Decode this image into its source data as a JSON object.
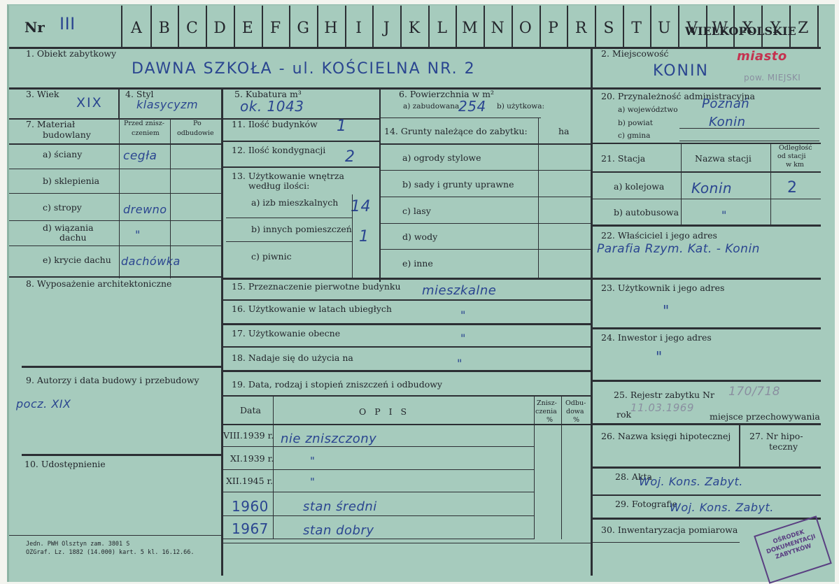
{
  "header": {
    "nr_label": "Nr",
    "nr_value": "III",
    "letters": [
      "A",
      "B",
      "C",
      "D",
      "E",
      "F",
      "G",
      "H",
      "I",
      "J",
      "K",
      "L",
      "M",
      "N",
      "O",
      "P",
      "R",
      "S",
      "T",
      "U",
      "V",
      "W",
      "X",
      "Y",
      "Z"
    ],
    "region": "WIELKOPOLSKIE"
  },
  "f1": {
    "label": "1. Obiekt zabytkowy",
    "value": "DAWNA SZKOŁA - ul. KOŚCIELNA NR. 2"
  },
  "f2": {
    "label": "2. Miejscowość",
    "value": "KONIN",
    "note": "miasto",
    "note2": "pow. MIEJSKI"
  },
  "f3": {
    "label": "3. Wiek",
    "value": "XIX"
  },
  "f4": {
    "label": "4. Styl",
    "value": "klasycyzm"
  },
  "f5": {
    "label": "5. Kubatura m³",
    "value": "ok. 1043"
  },
  "f6": {
    "label": "6. Powierzchnia w m²",
    "a_label": "a) zabudowana",
    "a_value": "254",
    "b_label": "b) użytkowa:"
  },
  "f20": {
    "label": "20. Przynależność administracyjna",
    "a_label": "a) województwo",
    "a_value": "Poznań",
    "b_label": "b) powiat",
    "b_value": "Konin",
    "c_label": "c) gmina"
  },
  "f7": {
    "label1": "7. Materiał",
    "label2": "budowlany",
    "col1a": "Przed znisz-",
    "col1b": "czeniem",
    "col2a": "Po",
    "col2b": "odbudowie",
    "rows": [
      {
        "label": "a) ściany",
        "value": "cegła"
      },
      {
        "label": "b) sklepienia",
        "value": ""
      },
      {
        "label": "c) stropy",
        "value": "drewno"
      },
      {
        "label1": "d) wiązania",
        "label2": "dachu",
        "value": "\""
      },
      {
        "label": "e) krycie dachu",
        "value": "dachówka"
      }
    ]
  },
  "f11": {
    "label": "11. Ilość budynków",
    "value": "1"
  },
  "f12": {
    "label": "12. Ilość kondygnacji",
    "value": "2"
  },
  "f13": {
    "label1": "13. Użytkowanie wnętrza",
    "label2": "według ilości:",
    "a_label": "a) izb mieszkalnych",
    "a_value": "14",
    "b_label": "b) innych pomieszczeń",
    "b_value": "1",
    "c_label": "c) piwnic"
  },
  "f14": {
    "label": "14. Grunty należące do zabytku:",
    "unit": "ha",
    "items": [
      "a) ogrody stylowe",
      "b) sady i grunty uprawne",
      "c) lasy",
      "d) wody",
      "e) inne"
    ]
  },
  "f21": {
    "label": "21. Stacja",
    "col_name": "Nazwa stacji",
    "col_dist1": "Odległość",
    "col_dist2": "od stacji",
    "col_dist3": "w km",
    "a_label": "a) kolejowa",
    "a_name": "Konin",
    "a_dist": "2",
    "b_label": "b) autobusowa",
    "b_name": "\""
  },
  "f22": {
    "label": "22. Właściciel i jego adres",
    "value": "Parafia Rzym. Kat. - Konin"
  },
  "f8": {
    "label": "8. Wyposażenie architektoniczne"
  },
  "f15": {
    "label": "15. Przeznaczenie pierwotne budynku",
    "value": "mieszkalne"
  },
  "f16": {
    "label": "16. Użytkowanie w latach ubiegłych",
    "value": "\""
  },
  "f17": {
    "label": "17. Użytkowanie obecne",
    "value": "\""
  },
  "f18": {
    "label": "18. Nadaje się do użycia na",
    "value": "\""
  },
  "f23": {
    "label": "23. Użytkownik i jego adres",
    "value": "\""
  },
  "f24": {
    "label": "24. Inwestor i jego adres",
    "value": "\""
  },
  "f9": {
    "label": "9. Autorzy i data budowy i przebudowy",
    "value": "pocz. XIX"
  },
  "f19": {
    "label": "19. Data, rodzaj i stopień zniszczeń i odbudowy",
    "col_date": "Data",
    "col_opis": "O P I S",
    "col_z1": "Znisz-",
    "col_z2": "czenia",
    "col_z3": "%",
    "col_o1": "Odbu-",
    "col_o2": "dowa",
    "col_o3": "%",
    "rows": [
      {
        "date": "VIII.1939 r.",
        "opis": "nie zniszczony"
      },
      {
        "date": "XI.1939 r.",
        "opis": "\""
      },
      {
        "date": "XII.1945 r.",
        "opis": "\""
      },
      {
        "date": "1960",
        "opis": "stan średni"
      },
      {
        "date": "1967",
        "opis": "stan dobry"
      }
    ]
  },
  "f25": {
    "label": "25. Rejestr zabytku Nr",
    "value": "170/718",
    "date": "11.03.1969",
    "line2_a": "rok",
    "line2_b": "miejsce przechowywania"
  },
  "f26": {
    "label": "26. Nazwa księgi hipotecznej"
  },
  "f27": {
    "label1": "27. Nr hipo-",
    "label2": "teczny"
  },
  "f10": {
    "label": "10. Udostępnienie"
  },
  "f28": {
    "label": "28. Akta",
    "value": "Woj. Kons. Zabyt."
  },
  "f29": {
    "label": "29. Fotografie",
    "value": "Woj. Kons. Zabyt."
  },
  "f30": {
    "label": "30. Inwentaryzacja pomiarowa"
  },
  "footer": {
    "line1": "Jedn. PWH Olsztyn zam. 3801 S",
    "line2": "OZGraf. Lz. 1882 (14.000) kart. 5 kl. 16.12.66."
  },
  "stamp": {
    "line1": "OŚRODEK",
    "line2": "DOKUMENTACJI",
    "line3": "ZABYTKÓW"
  }
}
